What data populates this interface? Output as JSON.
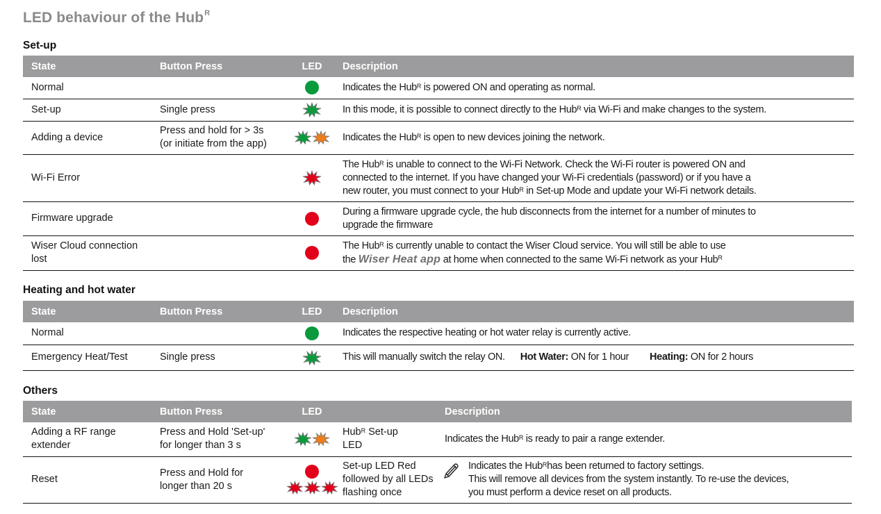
{
  "page": {
    "title": "LED behaviour of the Hub",
    "title_sup": "R"
  },
  "colors": {
    "header_bg": "#9c9c9e",
    "led_green": "#0a9a3c",
    "led_red": "#e2001a",
    "led_orange": "#ef7d1a",
    "star_outline": "#7a7a7a",
    "app_name": "#6f6f71"
  },
  "columns": {
    "state": "State",
    "button_press": "Button Press",
    "led": "LED",
    "description": "Description"
  },
  "sections": {
    "setup": {
      "title": "Set-up",
      "rows": [
        {
          "state": "Normal",
          "button_press": "",
          "led": "solid-green",
          "description": [
            "Indicates the Hub",
            "R",
            " is powered ON and operating as normal."
          ]
        },
        {
          "state": "Set-up",
          "button_press": "Single press",
          "led": "flashing-green",
          "description": [
            "In this mode, it is possible to connect directly to the Hub",
            "R",
            " via Wi-Fi and make changes to the system."
          ]
        },
        {
          "state": "Adding a device",
          "button_press": [
            "Press and hold for > 3s",
            "(or initiate from the app)"
          ],
          "led": "flashing-green-orange",
          "description": [
            "Indicates the Hub",
            "R",
            " is open to new devices joining the network."
          ]
        },
        {
          "state": "Wi-Fi Error",
          "button_press": "",
          "led": "flashing-red",
          "description": {
            "line1_a": "The Hub",
            "line1_sup": "R",
            "line1_b": " is unable to connect to the Wi-Fi Network. Check the Wi-Fi router is powered ON and",
            "line2": "connected to the internet. If you have changed your Wi-Fi credentials (password) or if you have a",
            "line3_a": "new router, you must connect to your Hub",
            "line3_sup": "R",
            "line3_b": " in Set-up Mode and update your Wi-Fi network details."
          }
        },
        {
          "state": "Firmware upgrade",
          "button_press": "",
          "led": "solid-red",
          "description": {
            "line1": "During a firmware upgrade cycle, the hub disconnects from the internet for a number of minutes to",
            "line2": "upgrade the firmware"
          }
        },
        {
          "state": [
            "Wiser Cloud connection",
            "lost"
          ],
          "button_press": "",
          "led": "solid-red",
          "description": {
            "line1_a": "The Hub",
            "line1_sup": "R",
            "line1_b": " is currently unable to contact the Wiser Cloud service. You will still be able to use",
            "line2_a": "the ",
            "line2_app": "Wiser Heat app",
            "line2_b": " at home when connected to the same Wi-Fi network as your Hub",
            "line2_sup": "R"
          }
        }
      ]
    },
    "heating": {
      "title": "Heating and hot water",
      "rows": [
        {
          "state": "Normal",
          "button_press": "",
          "led": "solid-green",
          "description": "Indicates the respective heating or hot water relay is currently active."
        },
        {
          "state": "Emergency Heat/Test",
          "button_press": "Single press",
          "led": "flashing-green",
          "description": {
            "text": "This will manually switch the relay ON.",
            "hot_water_label": "Hot Water:",
            "hot_water_value": " ON for 1 hour",
            "heating_label": "Heating:",
            "heating_value": " ON for 2 hours"
          }
        }
      ]
    },
    "others": {
      "title": "Others",
      "rows": [
        {
          "state": [
            "Adding a RF range",
            "extender"
          ],
          "button_press": [
            "Press and Hold 'Set-up'",
            "for longer than 3 s"
          ],
          "led": "flashing-green-orange",
          "led_label": {
            "a": "Hub",
            "sup": "R",
            "b": " Set-up",
            "line2": "LED"
          },
          "description": [
            "Indicates the Hub",
            "R",
            " is ready to pair a range extender."
          ]
        },
        {
          "state": "Reset",
          "button_press": [
            "Press and Hold for",
            "longer than 20 s"
          ],
          "led": "solid-red-then-three-flashing-red",
          "led_label": {
            "line1": "Set-up LED Red",
            "line2": "followed by all LEDs",
            "line3": "flashing once"
          },
          "icon": "pencil-note-icon",
          "description": {
            "line1_a": "Indicates the Hub",
            "line1_sup": "R",
            "line1_b": "has been returned to factory settings.",
            "line2": "This will remove all devices from the system instantly. To re-use the devices,",
            "line3": "you must perform a device reset on all products."
          }
        }
      ]
    }
  }
}
